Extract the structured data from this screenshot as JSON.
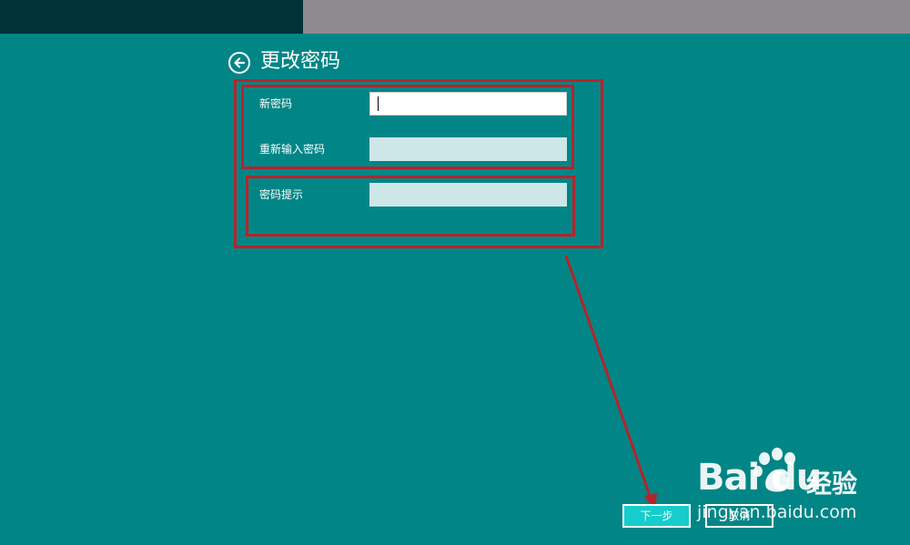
{
  "colors": {
    "background": "#028586",
    "topbar_left": "#003336",
    "topbar_right": "#8e8b8f",
    "annotation": "#b3252b",
    "next_button": "#16cccc"
  },
  "header": {
    "back_icon": "back-arrow-circle-icon",
    "title": "更改密码"
  },
  "form": {
    "new_password": {
      "label": "新密码",
      "value": ""
    },
    "confirm_password": {
      "label": "重新输入密码",
      "value": ""
    },
    "password_hint": {
      "label": "密码提示",
      "value": ""
    }
  },
  "buttons": {
    "next_label": "下一步",
    "cancel_label": "取消"
  },
  "watermark": {
    "brand": "Bai du",
    "brand_cn": "经验",
    "url": "jingyan.baidu.com"
  }
}
